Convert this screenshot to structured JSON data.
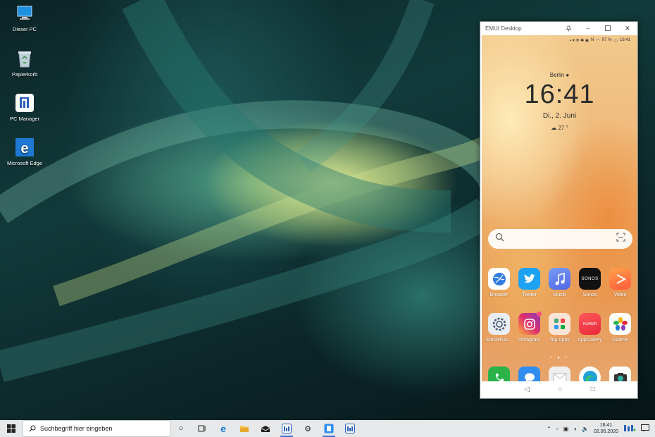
{
  "desktop": {
    "icons": [
      {
        "label": "Dieser PC",
        "icon": "computer-icon"
      },
      {
        "label": "Papierkorb",
        "icon": "recycle-bin-icon"
      },
      {
        "label": "PC Manager",
        "icon": "pc-manager-icon"
      },
      {
        "label": "Microsoft Edge",
        "icon": "edge-icon"
      }
    ]
  },
  "window": {
    "title": "EMUI Desktop",
    "buttons": [
      "pin-icon",
      "minimize-icon",
      "maximize-icon",
      "close-icon"
    ]
  },
  "phone": {
    "status": {
      "battery": "97 %",
      "time": "16:41"
    },
    "lockscreen": {
      "city": "Berlin",
      "time": "16:41",
      "date": "Di., 2. Juni",
      "temperature": "27 °"
    },
    "apps_row1": [
      {
        "label": "Browser",
        "color": "#ffffff"
      },
      {
        "label": "Twitter",
        "color": "#1da1f2"
      },
      {
        "label": "Musik",
        "color": "#5a7cf0"
      },
      {
        "label": "Sonos",
        "color": "#111111"
      },
      {
        "label": "Video",
        "color": "#ff7b2e"
      }
    ],
    "apps_row2": [
      {
        "label": "Einstellun...",
        "color": "#e9eef4"
      },
      {
        "label": "Instagram",
        "color": "#d6367a"
      },
      {
        "label": "Top Apps",
        "color": "#f1e4dc"
      },
      {
        "label": "AppGallery",
        "color": "#e8283a"
      },
      {
        "label": "Galerie",
        "color": "#ffffff"
      }
    ],
    "dock": [
      {
        "name": "phone-app",
        "color": "#2bb34a"
      },
      {
        "name": "messages-app",
        "color": "#2f8df0"
      },
      {
        "name": "email-app",
        "color": "#e8e8e8"
      },
      {
        "name": "edge-app",
        "color": "#ffffff"
      },
      {
        "name": "camera-app",
        "color": "#ffffff"
      }
    ],
    "sonos_text": "SONOS",
    "appgallery_text": "HUAWEI"
  },
  "taskbar": {
    "search_placeholder": "Suchbegriff hier eingeben",
    "clock_time": "16:41",
    "clock_date": "02.06.2020"
  }
}
